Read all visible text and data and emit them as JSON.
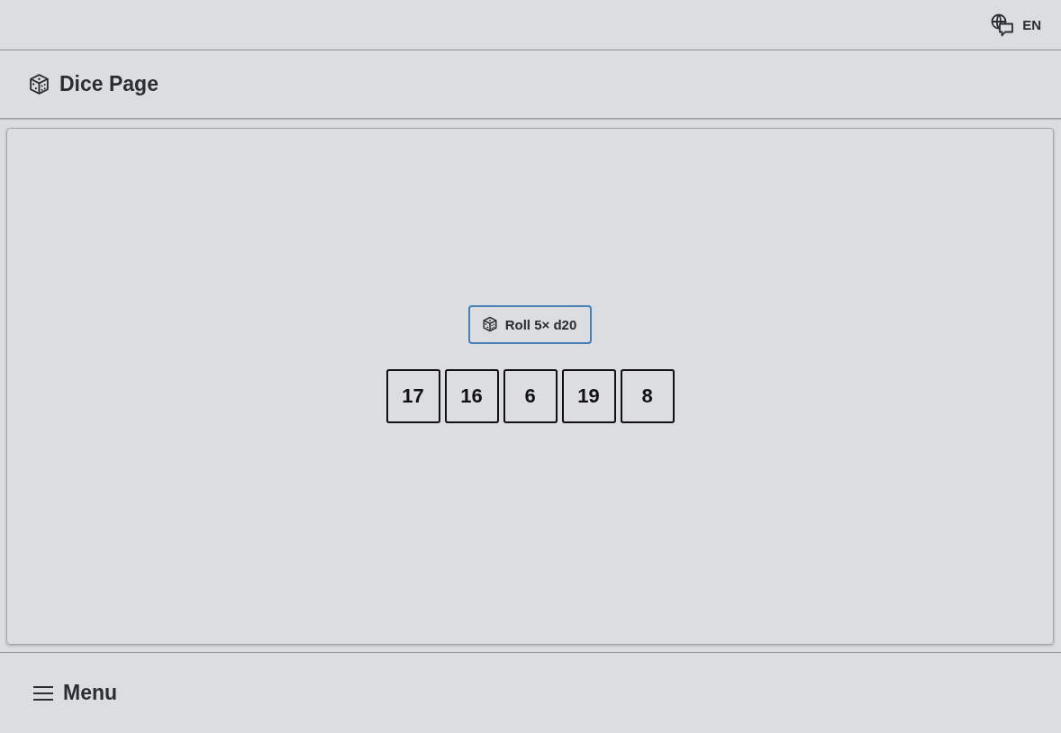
{
  "top_bar": {
    "language": "EN"
  },
  "header": {
    "title": "Dice Page"
  },
  "roll_button": {
    "label": "Roll **5× d20**"
  },
  "dice": [
    {
      "value": "17"
    },
    {
      "value": "16"
    },
    {
      "value": "6"
    },
    {
      "value": "19"
    },
    {
      "value": "8"
    }
  ],
  "footer": {
    "menu_label": "Menu"
  }
}
